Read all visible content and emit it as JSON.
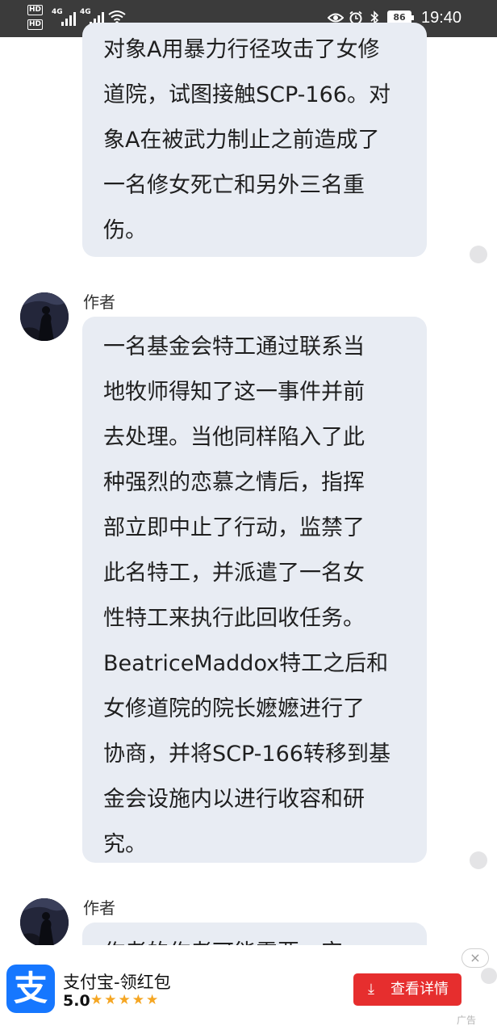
{
  "status_bar": {
    "hd1": "HD",
    "hd2": "HD",
    "net1": "4G",
    "net2": "4G",
    "battery": "86",
    "time": "19:40"
  },
  "messages": [
    {
      "lines": [
        "对象A用暴力行径攻击了女修",
        "道院，试图接触SCP-166。对",
        "象A在被武力制止之前造成了",
        "一名修女死亡和另外三名重",
        "伤。"
      ]
    },
    {
      "author": "作者",
      "lines": [
        "一名基金会特工通过联系当",
        "地牧师得知了这一事件并前",
        "去处理。当他同样陷入了此",
        "种强烈的恋慕之情后，指挥",
        "部立即中止了行动，监禁了",
        "此名特工，并派遣了一名女",
        "性特工来执行此回收任务。",
        "BeatriceMaddox特工之后和",
        "女修道院的院长嬷嬷进行了",
        "协商，并将SCP-166转移到基",
        "金会设施内以进行收容和研",
        "究。"
      ]
    },
    {
      "author": "作者",
      "lines": [
        "作者的作者可能需要一定"
      ]
    }
  ],
  "ad": {
    "app_name": "支付宝-领红包",
    "logo_glyph": "支",
    "rating": "5.0",
    "stars": "★★★★★",
    "button_label": "查看详情",
    "close_glyph": "×",
    "label": "广告"
  }
}
